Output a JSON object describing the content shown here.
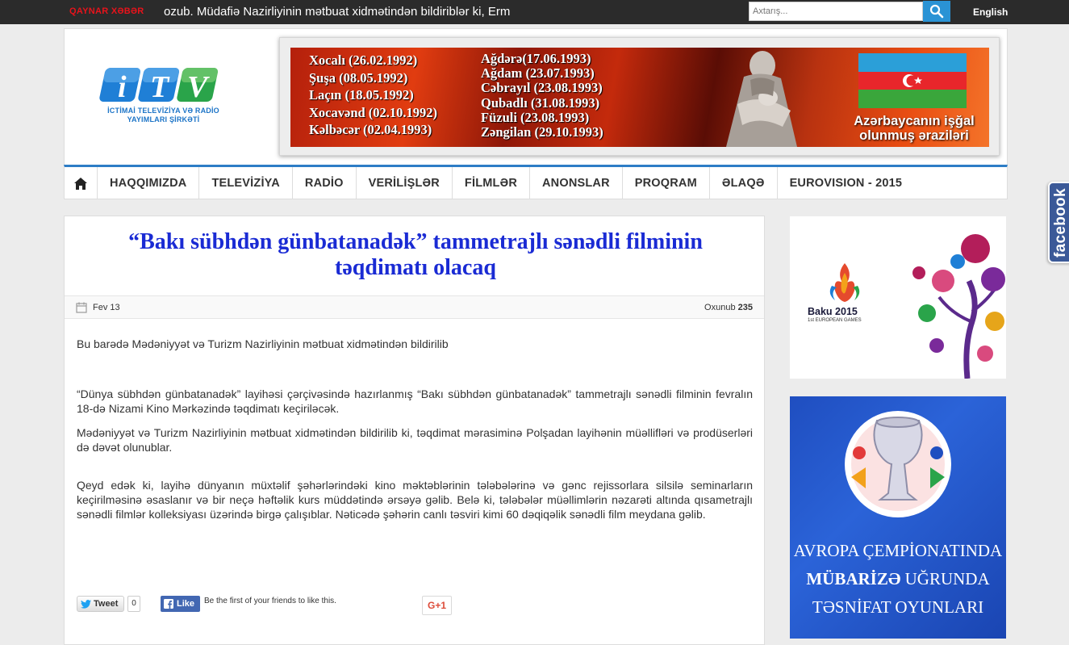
{
  "topbar": {
    "hot_label": "QAYNAR XƏBƏR",
    "ticker": "ozub. Müdafiə Nazirliyinin mətbuat xidmətindən bildiriblər ki, Erm",
    "search_placeholder": "Axtarış...",
    "language_link": "English"
  },
  "header": {
    "logo_caption": "İCTİMAİ TELEVİZİYA VƏ RADİO YAYIMLARI ŞİRKƏTİ",
    "banner": {
      "column1": [
        "Xocalı (26.02.1992)",
        "Şuşa (08.05.1992)",
        "Laçın (18.05.1992)",
        "Xocavənd (02.10.1992)",
        "Kəlbəcər (02.04.1993)"
      ],
      "column2": [
        "Ağdərə(17.06.1993)",
        "Ağdam (23.07.1993)",
        "Cəbrayıl (23.08.1993)",
        "Qubadlı (31.08.1993)",
        "Füzuli (23.08.1993)",
        "Zəngilan (29.10.1993)"
      ],
      "caption_line1": "Azərbaycanın işğal",
      "caption_line2": "olunmuş əraziləri"
    }
  },
  "nav": {
    "items": [
      "HAQQIMIZDA",
      "TELEVİZİYA",
      "RADİO",
      "VERİLİŞLƏR",
      "FİLMLƏR",
      "ANONSLAR",
      "PROQRAM",
      "ƏLAQƏ",
      "EUROVISION - 2015"
    ]
  },
  "article": {
    "title": "“Bakı sübhdən günbatanadək” tammetrajlı sənədli filminin təqdimatı olacaq",
    "date": "Fev 13",
    "read_label": "Oxunub",
    "read_count": "235",
    "paragraphs": [
      "Bu barədə Mədəniyyət və Turizm Nazirliyinin mətbuat xidmətindən bildirilib",
      "“Dünya sübhdən günbatanadək” layihəsi çərçivəsində hazırlanmış “Bakı sübhdən günbatanadək” tammetrajlı sənədli filminin fevralın 18-də Nizami Kino Mərkəzində təqdimatı keçiriləcək.",
      "Mədəniyyət və Turizm Nazirliyinin mətbuat xidmətindən bildirilib ki, təqdimat mərasiminə Polşadan layihənin müəllifləri və prodüserləri də dəvət olunublar.",
      "Qeyd edək ki, layihə dünyanın müxtəlif şəhərlərindəki kino məktəblərinin tələbələrinə və gənc rejissorlara silsilə seminarların keçirilməsinə əsaslanır və bir neçə həftəlik kurs müddətində ərsəyə gəlib. Belə ki, tələbələr müəllimlərin nəzarəti altında qısametrajlı sənədli filmlər kolleksiyası üzərində birgə çalışıblar. Nəticədə şəhərin canlı təsviri kimi 60 dəqiqəlik sənədli film meydana gəlib."
    ],
    "social": {
      "tweet": "Tweet",
      "tweet_count": "0",
      "like": "Like",
      "like_text": "Be the first of your friends to like this.",
      "gplus": "G+1"
    }
  },
  "sidebar": {
    "ad1_title": "Baku 2015",
    "ad1_sub": "1st EUROPEAN GAMES",
    "ad2_line1": "AVROPA ÇEMPİONATINDA",
    "ad2_line2_bold": "MÜBARİZƏ",
    "ad2_line2_rest": " UĞRUNDA",
    "ad2_line3": "TƏSNİFAT OYUNLARI"
  },
  "facebook_tab": "facebook",
  "colors": {
    "topbar": "#2b2b2b",
    "hot_label": "#e8131b",
    "nav_accent": "#2d7dc6",
    "title": "#1a2bd4",
    "fb_blue": "#3b5998"
  },
  "icons": [
    "search-icon",
    "home-icon",
    "calendar-icon",
    "twitter-icon",
    "facebook-icon"
  ]
}
